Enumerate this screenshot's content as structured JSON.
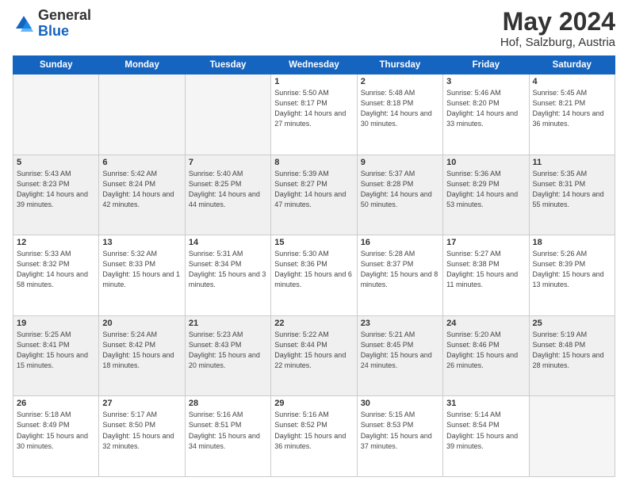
{
  "header": {
    "logo_general": "General",
    "logo_blue": "Blue",
    "month_year": "May 2024",
    "location": "Hof, Salzburg, Austria"
  },
  "days_of_week": [
    "Sunday",
    "Monday",
    "Tuesday",
    "Wednesday",
    "Thursday",
    "Friday",
    "Saturday"
  ],
  "weeks": [
    {
      "shade": false,
      "days": [
        {
          "num": "",
          "info": ""
        },
        {
          "num": "",
          "info": ""
        },
        {
          "num": "",
          "info": ""
        },
        {
          "num": "1",
          "info": "Sunrise: 5:50 AM\nSunset: 8:17 PM\nDaylight: 14 hours\nand 27 minutes."
        },
        {
          "num": "2",
          "info": "Sunrise: 5:48 AM\nSunset: 8:18 PM\nDaylight: 14 hours\nand 30 minutes."
        },
        {
          "num": "3",
          "info": "Sunrise: 5:46 AM\nSunset: 8:20 PM\nDaylight: 14 hours\nand 33 minutes."
        },
        {
          "num": "4",
          "info": "Sunrise: 5:45 AM\nSunset: 8:21 PM\nDaylight: 14 hours\nand 36 minutes."
        }
      ]
    },
    {
      "shade": true,
      "days": [
        {
          "num": "5",
          "info": "Sunrise: 5:43 AM\nSunset: 8:23 PM\nDaylight: 14 hours\nand 39 minutes."
        },
        {
          "num": "6",
          "info": "Sunrise: 5:42 AM\nSunset: 8:24 PM\nDaylight: 14 hours\nand 42 minutes."
        },
        {
          "num": "7",
          "info": "Sunrise: 5:40 AM\nSunset: 8:25 PM\nDaylight: 14 hours\nand 44 minutes."
        },
        {
          "num": "8",
          "info": "Sunrise: 5:39 AM\nSunset: 8:27 PM\nDaylight: 14 hours\nand 47 minutes."
        },
        {
          "num": "9",
          "info": "Sunrise: 5:37 AM\nSunset: 8:28 PM\nDaylight: 14 hours\nand 50 minutes."
        },
        {
          "num": "10",
          "info": "Sunrise: 5:36 AM\nSunset: 8:29 PM\nDaylight: 14 hours\nand 53 minutes."
        },
        {
          "num": "11",
          "info": "Sunrise: 5:35 AM\nSunset: 8:31 PM\nDaylight: 14 hours\nand 55 minutes."
        }
      ]
    },
    {
      "shade": false,
      "days": [
        {
          "num": "12",
          "info": "Sunrise: 5:33 AM\nSunset: 8:32 PM\nDaylight: 14 hours\nand 58 minutes."
        },
        {
          "num": "13",
          "info": "Sunrise: 5:32 AM\nSunset: 8:33 PM\nDaylight: 15 hours\nand 1 minute."
        },
        {
          "num": "14",
          "info": "Sunrise: 5:31 AM\nSunset: 8:34 PM\nDaylight: 15 hours\nand 3 minutes."
        },
        {
          "num": "15",
          "info": "Sunrise: 5:30 AM\nSunset: 8:36 PM\nDaylight: 15 hours\nand 6 minutes."
        },
        {
          "num": "16",
          "info": "Sunrise: 5:28 AM\nSunset: 8:37 PM\nDaylight: 15 hours\nand 8 minutes."
        },
        {
          "num": "17",
          "info": "Sunrise: 5:27 AM\nSunset: 8:38 PM\nDaylight: 15 hours\nand 11 minutes."
        },
        {
          "num": "18",
          "info": "Sunrise: 5:26 AM\nSunset: 8:39 PM\nDaylight: 15 hours\nand 13 minutes."
        }
      ]
    },
    {
      "shade": true,
      "days": [
        {
          "num": "19",
          "info": "Sunrise: 5:25 AM\nSunset: 8:41 PM\nDaylight: 15 hours\nand 15 minutes."
        },
        {
          "num": "20",
          "info": "Sunrise: 5:24 AM\nSunset: 8:42 PM\nDaylight: 15 hours\nand 18 minutes."
        },
        {
          "num": "21",
          "info": "Sunrise: 5:23 AM\nSunset: 8:43 PM\nDaylight: 15 hours\nand 20 minutes."
        },
        {
          "num": "22",
          "info": "Sunrise: 5:22 AM\nSunset: 8:44 PM\nDaylight: 15 hours\nand 22 minutes."
        },
        {
          "num": "23",
          "info": "Sunrise: 5:21 AM\nSunset: 8:45 PM\nDaylight: 15 hours\nand 24 minutes."
        },
        {
          "num": "24",
          "info": "Sunrise: 5:20 AM\nSunset: 8:46 PM\nDaylight: 15 hours\nand 26 minutes."
        },
        {
          "num": "25",
          "info": "Sunrise: 5:19 AM\nSunset: 8:48 PM\nDaylight: 15 hours\nand 28 minutes."
        }
      ]
    },
    {
      "shade": false,
      "days": [
        {
          "num": "26",
          "info": "Sunrise: 5:18 AM\nSunset: 8:49 PM\nDaylight: 15 hours\nand 30 minutes."
        },
        {
          "num": "27",
          "info": "Sunrise: 5:17 AM\nSunset: 8:50 PM\nDaylight: 15 hours\nand 32 minutes."
        },
        {
          "num": "28",
          "info": "Sunrise: 5:16 AM\nSunset: 8:51 PM\nDaylight: 15 hours\nand 34 minutes."
        },
        {
          "num": "29",
          "info": "Sunrise: 5:16 AM\nSunset: 8:52 PM\nDaylight: 15 hours\nand 36 minutes."
        },
        {
          "num": "30",
          "info": "Sunrise: 5:15 AM\nSunset: 8:53 PM\nDaylight: 15 hours\nand 37 minutes."
        },
        {
          "num": "31",
          "info": "Sunrise: 5:14 AM\nSunset: 8:54 PM\nDaylight: 15 hours\nand 39 minutes."
        },
        {
          "num": "",
          "info": ""
        }
      ]
    }
  ]
}
